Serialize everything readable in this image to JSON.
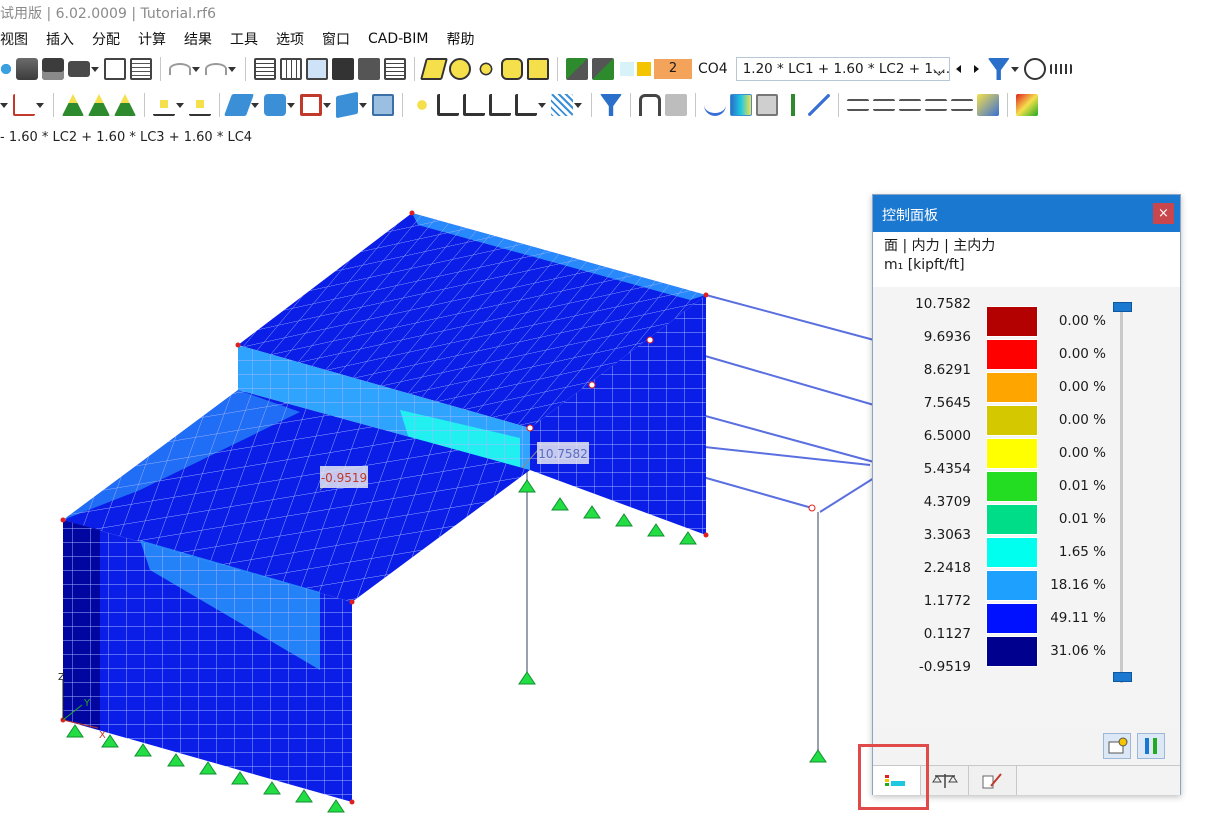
{
  "window": {
    "title": "试用版 | 6.02.0009 | Tutorial.rf6"
  },
  "menu": [
    "视图",
    "插入",
    "分配",
    "计算",
    "结果",
    "工具",
    "选项",
    "窗口",
    "CAD-BIM",
    "帮助"
  ],
  "loadcase": {
    "number": "2",
    "combo_id": "CO4",
    "formula": "1.20 * LC1 + 1.60 * LC2 + 1....",
    "full_line": "- 1.60 * LC2 + 1.60 * LC3 + 1.60 * LC4"
  },
  "model_labels": {
    "min": "-0.9519",
    "max": "10.7582",
    "axis_z": "Z",
    "axis_y": "Y",
    "axis_x": "X"
  },
  "panel": {
    "title": "控制面板",
    "close": "×",
    "subtitle": "面 | 内力 | 主内力",
    "quantity": "m₁ [kipft/ft]",
    "values": [
      "10.7582",
      "9.6936",
      "8.6291",
      "7.5645",
      "6.5000",
      "5.4354",
      "4.3709",
      "3.3063",
      "2.2418",
      "1.1772",
      "0.1127",
      "-0.9519"
    ],
    "colors": [
      "#b30000",
      "#ff0000",
      "#ffa500",
      "#d4c800",
      "#ffff00",
      "#22dd22",
      "#00dd88",
      "#00ffee",
      "#1ea0ff",
      "#0011ff",
      "#00008f"
    ],
    "percents": [
      "0.00 %",
      "0.00 %",
      "0.00 %",
      "0.00 %",
      "0.00 %",
      "0.01 %",
      "0.01 %",
      "1.65 %",
      "18.16 %",
      "49.11 %",
      "31.06 %"
    ]
  },
  "icons": {
    "panel_tabs": [
      "color-scale-icon",
      "balance-icon",
      "edit-settings-icon"
    ],
    "panel_buttons": [
      "settings-icon",
      "scale-range-icon"
    ]
  }
}
